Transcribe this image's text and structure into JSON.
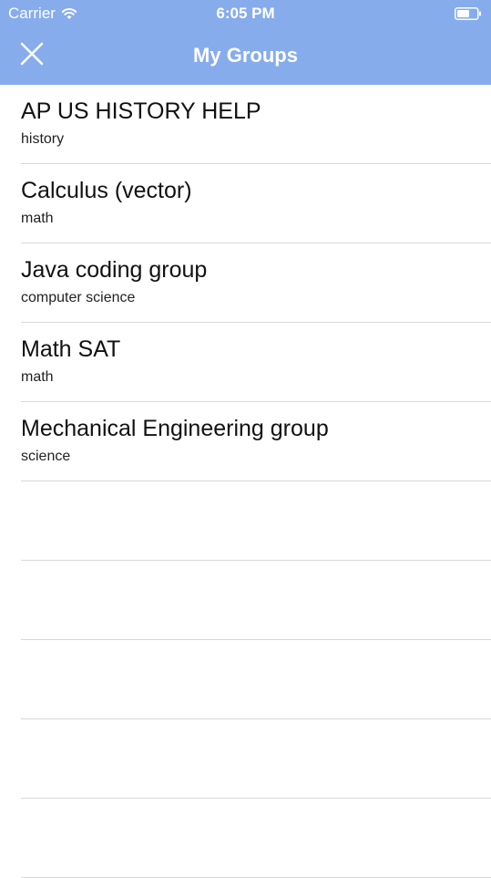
{
  "status_bar": {
    "carrier": "Carrier",
    "time": "6:05 PM",
    "wifi_icon": "wifi-icon",
    "battery_icon": "battery-icon"
  },
  "nav": {
    "title": "My Groups",
    "close_icon": "close-icon"
  },
  "colors": {
    "header_bg": "#86acec",
    "separator": "#d8d8d8"
  },
  "groups": [
    {
      "name": "AP US HISTORY HELP",
      "subject": "history"
    },
    {
      "name": "Calculus (vector)",
      "subject": "math"
    },
    {
      "name": "Java coding group",
      "subject": "computer science"
    },
    {
      "name": "Math SAT",
      "subject": "math"
    },
    {
      "name": "Mechanical Engineering group",
      "subject": "science"
    }
  ]
}
